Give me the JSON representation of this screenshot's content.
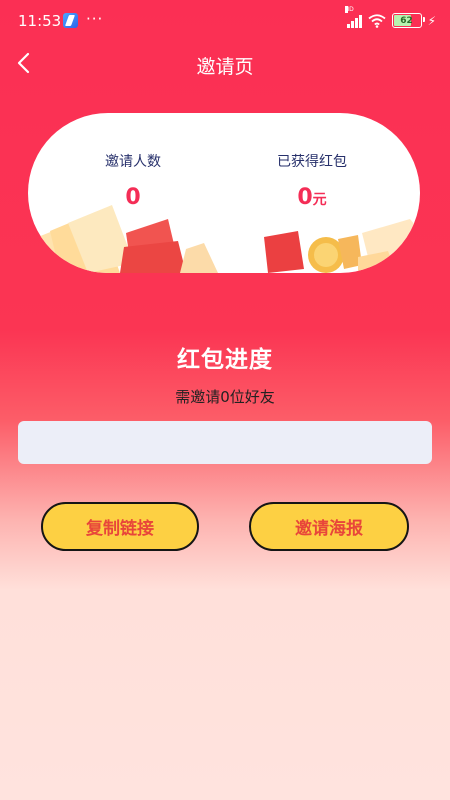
{
  "status": {
    "time": "11:53",
    "dots": "···",
    "network": "HD",
    "battery": "62"
  },
  "nav": {
    "title": "邀请页"
  },
  "stats": {
    "invite_label": "邀请人数",
    "invite_value": "0",
    "earned_label": "已获得红包",
    "earned_value": "0",
    "earned_unit": "元"
  },
  "progress": {
    "title": "红包进度",
    "subtitle": "需邀请0位好友",
    "fraction": 0
  },
  "actions": {
    "copy_label": "复制链接",
    "poster_label": "邀请海报"
  },
  "colors": {
    "accent": "#fb2f54",
    "button": "#fdd043",
    "value_text": "#f42d56"
  }
}
